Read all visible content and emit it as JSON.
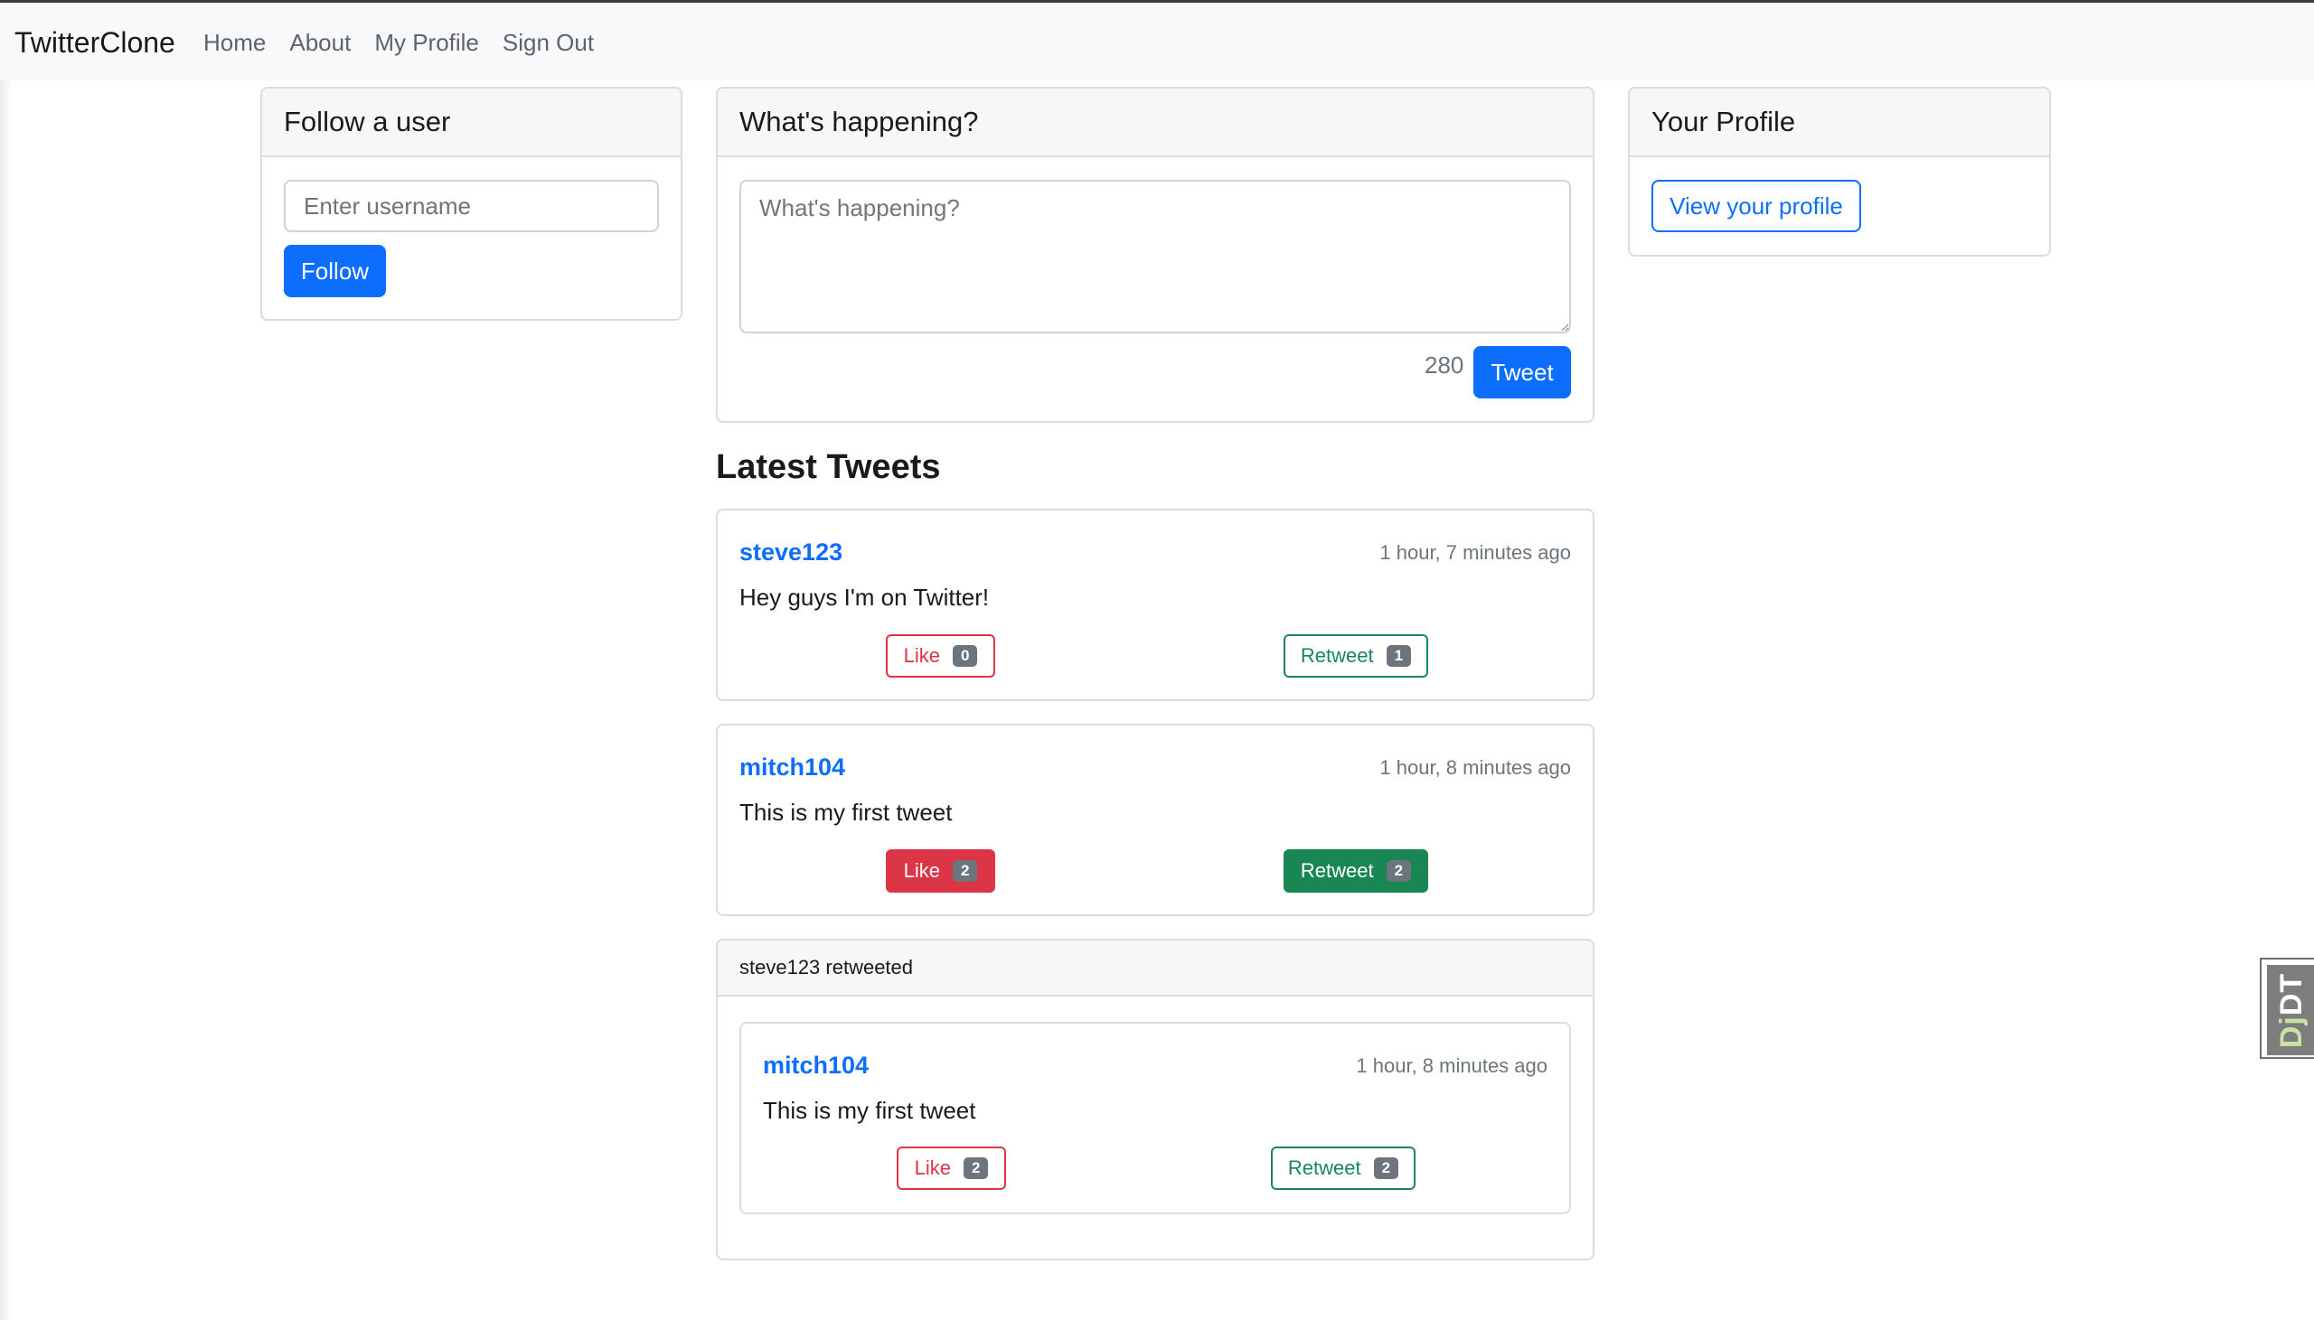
{
  "navbar": {
    "brand": "TwitterClone",
    "links": [
      "Home",
      "About",
      "My Profile",
      "Sign Out"
    ]
  },
  "follow_card": {
    "title": "Follow a user",
    "input_placeholder": "Enter username",
    "button_label": "Follow"
  },
  "compose_card": {
    "title": "What's happening?",
    "textarea_placeholder": "What's happening?",
    "char_count": "280",
    "button_label": "Tweet"
  },
  "profile_card": {
    "title": "Your Profile",
    "button_label": "View your profile"
  },
  "feed": {
    "title": "Latest Tweets",
    "tweets": [
      {
        "user": "steve123",
        "time": "1 hour, 7 minutes ago",
        "text": "Hey guys I'm on Twitter!",
        "like_label": "Like",
        "like_count": "0",
        "retweet_label": "Retweet",
        "retweet_count": "1"
      },
      {
        "user": "mitch104",
        "time": "1 hour, 8 minutes ago",
        "text": "This is my first tweet",
        "like_label": "Like",
        "like_count": "2",
        "retweet_label": "Retweet",
        "retweet_count": "2"
      }
    ],
    "retweet": {
      "header": "steve123 retweeted",
      "user": "mitch104",
      "time": "1 hour, 8 minutes ago",
      "text": "This is my first tweet",
      "like_label": "Like",
      "like_count": "2",
      "retweet_label": "Retweet",
      "retweet_count": "2"
    }
  },
  "debug_toolbar": {
    "label_dj": "Dj",
    "label_dt": "DT"
  },
  "colors": {
    "primary": "#0d6efd",
    "danger": "#dc3545",
    "success": "#198754",
    "secondary": "#6c757d"
  }
}
